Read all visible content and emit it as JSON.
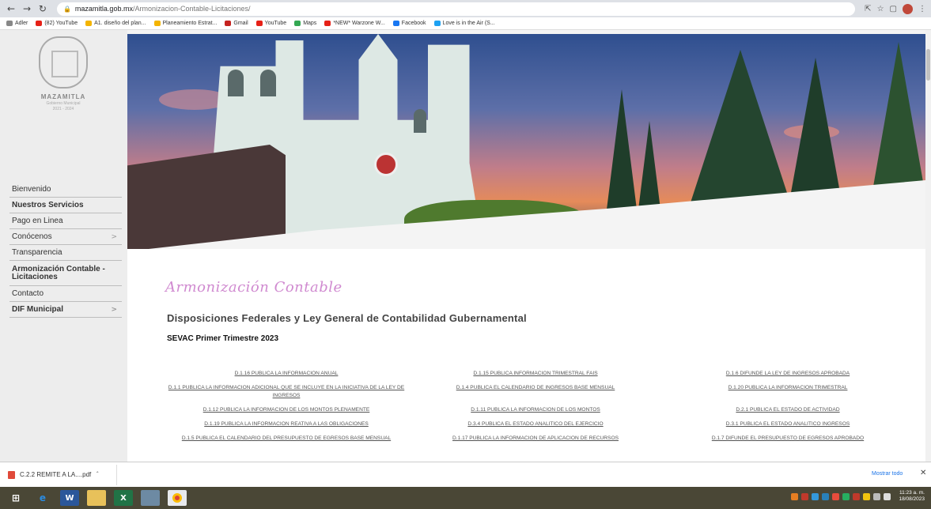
{
  "browser": {
    "url_host": "mazamitla.gob.mx",
    "url_path": "/Armonizacion-Contable-Licitaciones/",
    "bookmarks": [
      {
        "label": "Adler",
        "color": "#888888"
      },
      {
        "label": "(82) YouTube",
        "color": "#e62117"
      },
      {
        "label": "A1. diseño del plan...",
        "color": "#f4b400"
      },
      {
        "label": "Planeamiento Estrat...",
        "color": "#f4b400"
      },
      {
        "label": "Gmail",
        "color": "#c5221f"
      },
      {
        "label": "YouTube",
        "color": "#e62117"
      },
      {
        "label": "Maps",
        "color": "#34a853"
      },
      {
        "label": "*NEW* Warzone W...",
        "color": "#e62117"
      },
      {
        "label": "Facebook",
        "color": "#1877f2"
      },
      {
        "label": "Love is in the Air (S...",
        "color": "#1da1f2"
      }
    ]
  },
  "logo": {
    "name": "MAZAMITLA",
    "subtitle": "Gobierno Municipal",
    "years": "2021 - 2024"
  },
  "nav": {
    "items": [
      {
        "label": "Bienvenido",
        "chevron": false
      },
      {
        "label": "Nuestros Servicios",
        "chevron": false
      },
      {
        "label": "Pago en Linea",
        "chevron": false
      },
      {
        "label": "Conócenos",
        "chevron": true
      },
      {
        "label": "Transparencia",
        "chevron": false
      },
      {
        "label": "Armonización Contable - Licitaciones",
        "chevron": false
      },
      {
        "label": "Contacto",
        "chevron": false
      },
      {
        "label": "DIF Municipal",
        "chevron": true
      }
    ],
    "chevron_glyph": ">"
  },
  "content": {
    "script_title": "Armonización Contable",
    "heading": "Disposiciones Federales y Ley General de Contabilidad Gubernamental",
    "subheading": "SEVAC Primer Trimestre 2023",
    "links": [
      "D.1.16 PUBLICA LA INFORMACION ANUAL",
      "D.1.15 PUBLICA INFORMACION TRIMESTRAL FAIS",
      "D.1.6 DIFUNDE LA LEY DE INGRESOS APROBADA",
      "D.1.1 PUBLICA LA INFORMACION ADICIONAL QUE SE INCLUYE EN LA INICIATIVA DE LA LEY DE INGRESOS",
      "D.1.4 PUBLICA EL CALENDARIO DE INGRESOS BASE MENSUAL",
      "D.1.20 PUBLICA LA INFORMACION TRIMESTRAL",
      "D.1.12 PUBLICA LA INFORMACION DE LOS MONTOS PLENAMENTE",
      "D.1.11 PUBLICA LA INFORMACION DE LOS MONTOS",
      "D.2.1 PUBLICA EL ESTADO DE ACTIVIDAD",
      "D.1.19 PUBLICA LA INFORMACION REATIVA A LAS OBLIGACIONES",
      "D.3.4 PUBLICA EL ESTADO ANALITICO DEL EJERCICIO",
      "D.3.1 PUBLICA EL ESTADO ANALITICO INGRESOS",
      "D.1.5 PUBLICA EL CALENDARIO DEL PRESUPUESTO DE EGRESOS BASE MENSUAL",
      "D.1.17 PUBLICA LA INFORMACION DE APLICACION DE RECURSOS",
      "D.1.7 DIFUNDE EL PRESUPUESTO DE EGRESOS APROBADO"
    ]
  },
  "downloads": {
    "file": "C.2.2 REMITE A LA....pdf",
    "show_all": "Mostrar todo"
  },
  "taskbar": {
    "time": "11:23 a. m.",
    "date": "18/08/2023"
  }
}
